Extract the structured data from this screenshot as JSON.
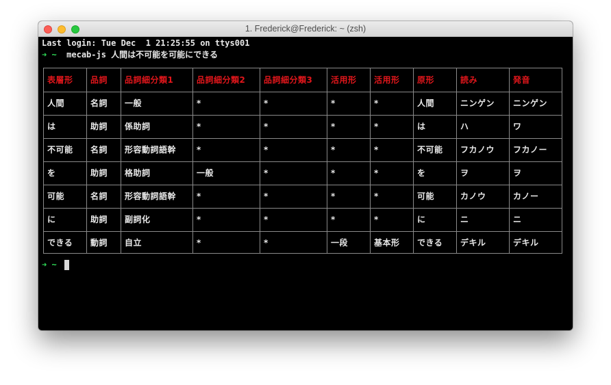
{
  "window": {
    "title": "1. Frederick@Frederick: ~ (zsh)"
  },
  "terminal": {
    "last_login": "Last login: Tue Dec  1 21:25:55 on ttys001",
    "prompt_arrow": "➜",
    "prompt_dir": "~",
    "command": "mecab-js 人間は不可能を可能にできる",
    "colors": {
      "background": "#000000",
      "text": "#e8e8e8",
      "prompt": "#2fdc58",
      "header": "#e0161b",
      "grid": "#8a8a8a"
    }
  },
  "table": {
    "headers": [
      "表層形",
      "品詞",
      "品詞細分類1",
      "品詞細分類2",
      "品詞細分類3",
      "活用形",
      "活用形",
      "原形",
      "読み",
      "発音"
    ],
    "rows": [
      [
        "人間",
        "名詞",
        "一般",
        "*",
        "*",
        "*",
        "*",
        "人間",
        "ニンゲン",
        "ニンゲン"
      ],
      [
        "は",
        "助詞",
        "係助詞",
        "*",
        "*",
        "*",
        "*",
        "は",
        "ハ",
        "ワ"
      ],
      [
        "不可能",
        "名詞",
        "形容動詞語幹",
        "*",
        "*",
        "*",
        "*",
        "不可能",
        "フカノウ",
        "フカノー"
      ],
      [
        "を",
        "助詞",
        "格助詞",
        "一般",
        "*",
        "*",
        "*",
        "を",
        "ヲ",
        "ヲ"
      ],
      [
        "可能",
        "名詞",
        "形容動詞語幹",
        "*",
        "*",
        "*",
        "*",
        "可能",
        "カノウ",
        "カノー"
      ],
      [
        "に",
        "助詞",
        "副詞化",
        "*",
        "*",
        "*",
        "*",
        "に",
        "ニ",
        "ニ"
      ],
      [
        "できる",
        "動詞",
        "自立",
        "*",
        "*",
        "一段",
        "基本形",
        "できる",
        "デキル",
        "デキル"
      ]
    ]
  }
}
